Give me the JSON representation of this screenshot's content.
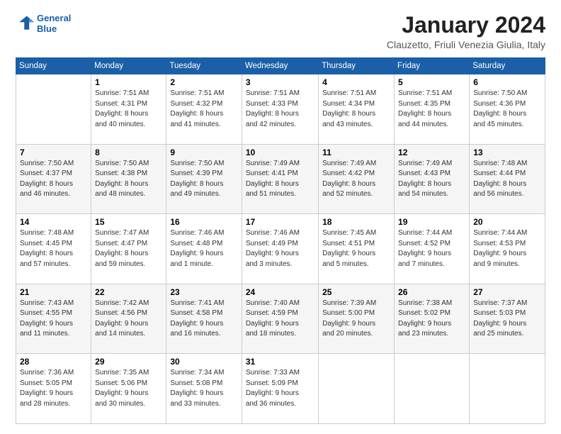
{
  "logo": {
    "line1": "General",
    "line2": "Blue"
  },
  "title": "January 2024",
  "location": "Clauzetto, Friuli Venezia Giulia, Italy",
  "headers": [
    "Sunday",
    "Monday",
    "Tuesday",
    "Wednesday",
    "Thursday",
    "Friday",
    "Saturday"
  ],
  "weeks": [
    [
      {
        "day": "",
        "info": ""
      },
      {
        "day": "1",
        "info": "Sunrise: 7:51 AM\nSunset: 4:31 PM\nDaylight: 8 hours\nand 40 minutes."
      },
      {
        "day": "2",
        "info": "Sunrise: 7:51 AM\nSunset: 4:32 PM\nDaylight: 8 hours\nand 41 minutes."
      },
      {
        "day": "3",
        "info": "Sunrise: 7:51 AM\nSunset: 4:33 PM\nDaylight: 8 hours\nand 42 minutes."
      },
      {
        "day": "4",
        "info": "Sunrise: 7:51 AM\nSunset: 4:34 PM\nDaylight: 8 hours\nand 43 minutes."
      },
      {
        "day": "5",
        "info": "Sunrise: 7:51 AM\nSunset: 4:35 PM\nDaylight: 8 hours\nand 44 minutes."
      },
      {
        "day": "6",
        "info": "Sunrise: 7:50 AM\nSunset: 4:36 PM\nDaylight: 8 hours\nand 45 minutes."
      }
    ],
    [
      {
        "day": "7",
        "info": "Sunrise: 7:50 AM\nSunset: 4:37 PM\nDaylight: 8 hours\nand 46 minutes."
      },
      {
        "day": "8",
        "info": "Sunrise: 7:50 AM\nSunset: 4:38 PM\nDaylight: 8 hours\nand 48 minutes."
      },
      {
        "day": "9",
        "info": "Sunrise: 7:50 AM\nSunset: 4:39 PM\nDaylight: 8 hours\nand 49 minutes."
      },
      {
        "day": "10",
        "info": "Sunrise: 7:49 AM\nSunset: 4:41 PM\nDaylight: 8 hours\nand 51 minutes."
      },
      {
        "day": "11",
        "info": "Sunrise: 7:49 AM\nSunset: 4:42 PM\nDaylight: 8 hours\nand 52 minutes."
      },
      {
        "day": "12",
        "info": "Sunrise: 7:49 AM\nSunset: 4:43 PM\nDaylight: 8 hours\nand 54 minutes."
      },
      {
        "day": "13",
        "info": "Sunrise: 7:48 AM\nSunset: 4:44 PM\nDaylight: 8 hours\nand 56 minutes."
      }
    ],
    [
      {
        "day": "14",
        "info": "Sunrise: 7:48 AM\nSunset: 4:45 PM\nDaylight: 8 hours\nand 57 minutes."
      },
      {
        "day": "15",
        "info": "Sunrise: 7:47 AM\nSunset: 4:47 PM\nDaylight: 8 hours\nand 59 minutes."
      },
      {
        "day": "16",
        "info": "Sunrise: 7:46 AM\nSunset: 4:48 PM\nDaylight: 9 hours\nand 1 minute."
      },
      {
        "day": "17",
        "info": "Sunrise: 7:46 AM\nSunset: 4:49 PM\nDaylight: 9 hours\nand 3 minutes."
      },
      {
        "day": "18",
        "info": "Sunrise: 7:45 AM\nSunset: 4:51 PM\nDaylight: 9 hours\nand 5 minutes."
      },
      {
        "day": "19",
        "info": "Sunrise: 7:44 AM\nSunset: 4:52 PM\nDaylight: 9 hours\nand 7 minutes."
      },
      {
        "day": "20",
        "info": "Sunrise: 7:44 AM\nSunset: 4:53 PM\nDaylight: 9 hours\nand 9 minutes."
      }
    ],
    [
      {
        "day": "21",
        "info": "Sunrise: 7:43 AM\nSunset: 4:55 PM\nDaylight: 9 hours\nand 11 minutes."
      },
      {
        "day": "22",
        "info": "Sunrise: 7:42 AM\nSunset: 4:56 PM\nDaylight: 9 hours\nand 14 minutes."
      },
      {
        "day": "23",
        "info": "Sunrise: 7:41 AM\nSunset: 4:58 PM\nDaylight: 9 hours\nand 16 minutes."
      },
      {
        "day": "24",
        "info": "Sunrise: 7:40 AM\nSunset: 4:59 PM\nDaylight: 9 hours\nand 18 minutes."
      },
      {
        "day": "25",
        "info": "Sunrise: 7:39 AM\nSunset: 5:00 PM\nDaylight: 9 hours\nand 20 minutes."
      },
      {
        "day": "26",
        "info": "Sunrise: 7:38 AM\nSunset: 5:02 PM\nDaylight: 9 hours\nand 23 minutes."
      },
      {
        "day": "27",
        "info": "Sunrise: 7:37 AM\nSunset: 5:03 PM\nDaylight: 9 hours\nand 25 minutes."
      }
    ],
    [
      {
        "day": "28",
        "info": "Sunrise: 7:36 AM\nSunset: 5:05 PM\nDaylight: 9 hours\nand 28 minutes."
      },
      {
        "day": "29",
        "info": "Sunrise: 7:35 AM\nSunset: 5:06 PM\nDaylight: 9 hours\nand 30 minutes."
      },
      {
        "day": "30",
        "info": "Sunrise: 7:34 AM\nSunset: 5:08 PM\nDaylight: 9 hours\nand 33 minutes."
      },
      {
        "day": "31",
        "info": "Sunrise: 7:33 AM\nSunset: 5:09 PM\nDaylight: 9 hours\nand 36 minutes."
      },
      {
        "day": "",
        "info": ""
      },
      {
        "day": "",
        "info": ""
      },
      {
        "day": "",
        "info": ""
      }
    ]
  ]
}
